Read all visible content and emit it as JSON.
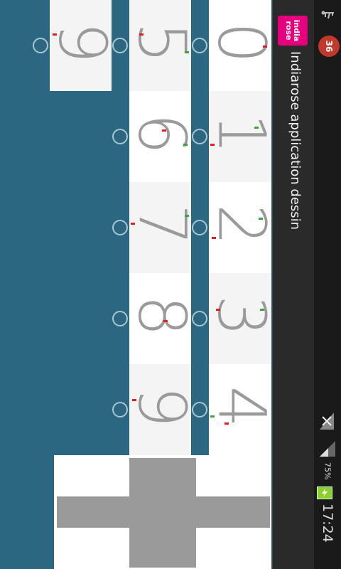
{
  "app": {
    "title": "Indiarose application dessin",
    "logo_text": "india rose"
  },
  "status_bar": {
    "battery": "75%",
    "time": "17:24",
    "notification_badge": "36"
  },
  "digits": {
    "col_a": [
      "0",
      "1",
      "2",
      "3",
      "4"
    ],
    "col_b": [
      "5",
      "6",
      "7",
      "8",
      "9"
    ],
    "col_c": [
      "9"
    ]
  },
  "colors": {
    "background": "#2b6781",
    "logo": "#e6007e",
    "digit": "#9a9a9a"
  },
  "icons": {
    "add": "plus-icon",
    "usb": "usb-icon",
    "battery": "battery-charging-icon",
    "signal": "signal-icon"
  }
}
